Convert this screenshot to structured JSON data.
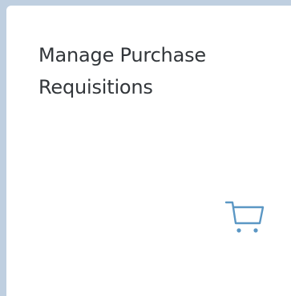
{
  "tile": {
    "title": "Manage Purchase Requisitions",
    "icon": "shopping-cart-icon",
    "icon_color": "#5b97c4",
    "background": "#ffffff",
    "border_color": "#bfcfe0"
  }
}
